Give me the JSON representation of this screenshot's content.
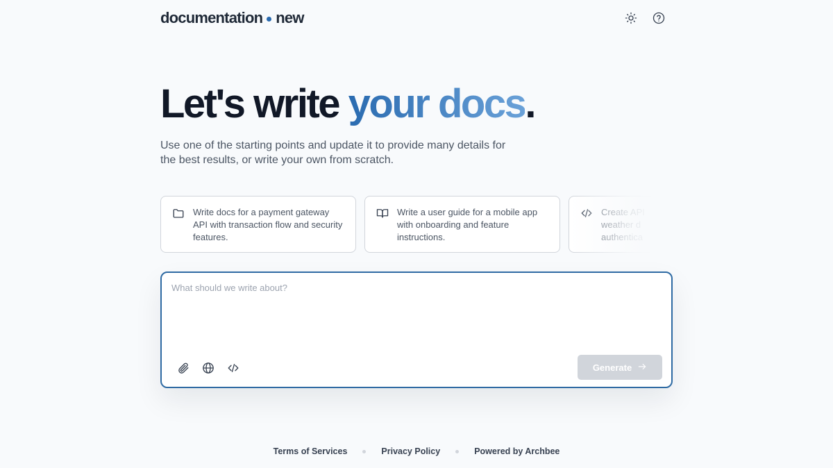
{
  "header": {
    "logo_left": "documentation",
    "logo_right": "new",
    "icons": [
      "sun-icon",
      "help-circle-icon"
    ]
  },
  "hero": {
    "title_plain": "Let's write ",
    "title_highlight": "your docs",
    "title_period": ".",
    "subtitle": "Use one of the starting points and update it to provide many details for the best results, or write your own from scratch."
  },
  "suggestions": [
    {
      "icon": "folder-icon",
      "text": "Write docs for a payment gateway API with transaction flow and security features."
    },
    {
      "icon": "book-open-icon",
      "text": "Write a user guide for a mobile app with onboarding and feature instructions."
    },
    {
      "icon": "code-icon",
      "text": "Create API weather d authentica"
    }
  ],
  "composer": {
    "placeholder": "What should we write about?",
    "value": "",
    "tools": [
      "paperclip-icon",
      "globe-icon",
      "code-icon"
    ],
    "generate_label": "Generate"
  },
  "footer": {
    "links": [
      "Terms of Services",
      "Privacy Policy",
      "Powered by Archbee"
    ]
  },
  "colors": {
    "accent": "#2e6aa3",
    "gradient_start": "#2a6bb0",
    "gradient_end": "#6aa1d8",
    "generate_disabled": "#d1d5db",
    "background": "#f8fafc"
  }
}
